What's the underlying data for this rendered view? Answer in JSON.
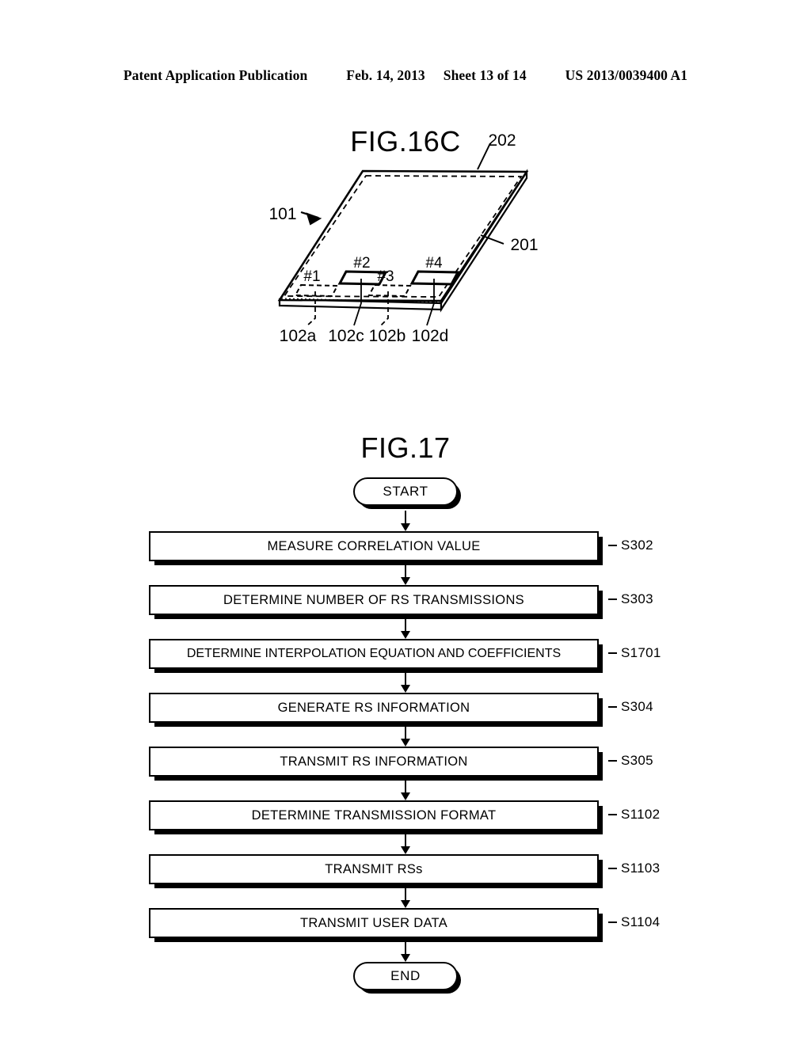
{
  "header": {
    "publication": "Patent Application Publication",
    "date": "Feb. 14, 2013",
    "sheet": "Sheet 13 of 14",
    "docnumber": "US 2013/0039400 A1"
  },
  "fig16c": {
    "title": "FIG.16C",
    "refs": {
      "device": "101",
      "substrate_top": "202",
      "substrate_side": "201",
      "element_a": "102a",
      "element_c": "102c",
      "element_b": "102b",
      "element_d": "102d"
    },
    "elements": [
      {
        "tag": "#1",
        "ref": "102a",
        "style": "dashed"
      },
      {
        "tag": "#2",
        "ref": "102c",
        "style": "solid"
      },
      {
        "tag": "#3",
        "ref": "102b",
        "style": "dashed"
      },
      {
        "tag": "#4",
        "ref": "102d",
        "style": "solid"
      }
    ]
  },
  "fig17": {
    "title": "FIG.17",
    "start_label": "START",
    "end_label": "END",
    "steps": [
      {
        "label": "MEASURE CORRELATION VALUE",
        "ref": "S302"
      },
      {
        "label": "DETERMINE NUMBER OF RS TRANSMISSIONS",
        "ref": "S303"
      },
      {
        "label": "DETERMINE INTERPOLATION EQUATION AND COEFFICIENTS",
        "ref": "S1701"
      },
      {
        "label": "GENERATE RS INFORMATION",
        "ref": "S304"
      },
      {
        "label": "TRANSMIT RS INFORMATION",
        "ref": "S305"
      },
      {
        "label": "DETERMINE TRANSMISSION FORMAT",
        "ref": "S1102"
      },
      {
        "label": "TRANSMIT RSs",
        "ref": "S1103"
      },
      {
        "label": "TRANSMIT USER DATA",
        "ref": "S1104"
      }
    ]
  },
  "colors": {
    "ink": "#000000",
    "paper": "#ffffff"
  }
}
